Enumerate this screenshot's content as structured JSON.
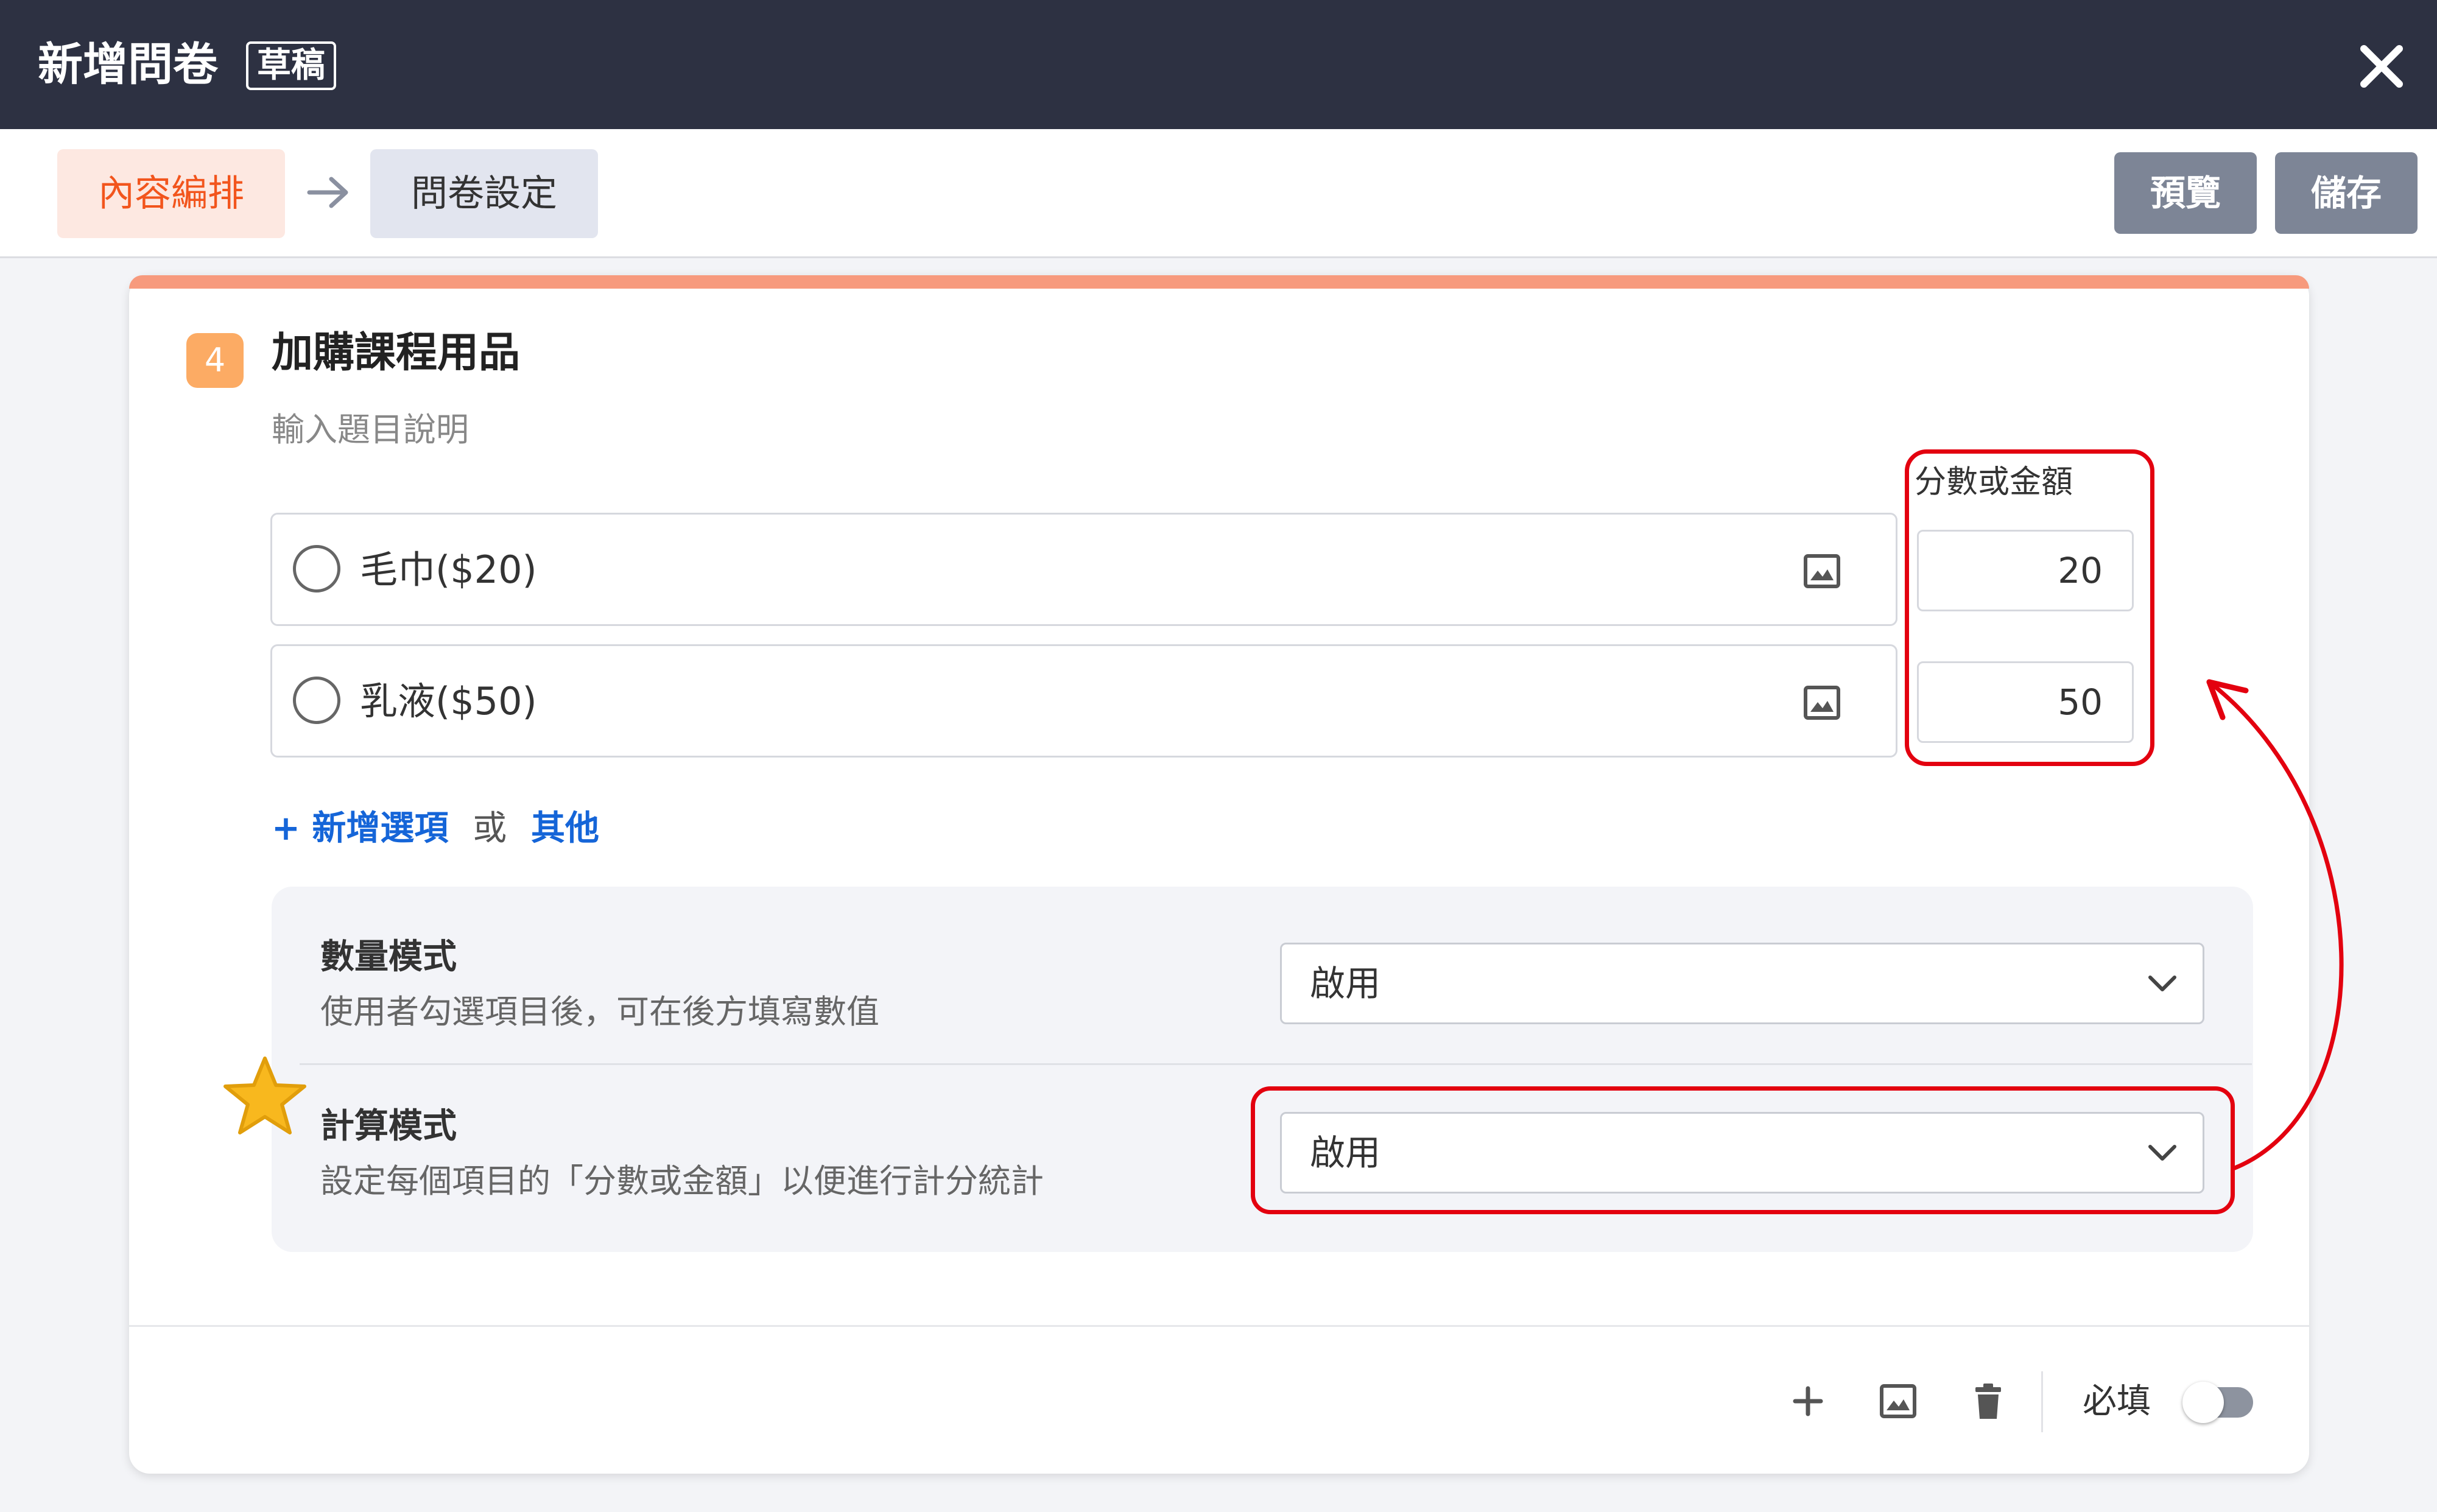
{
  "header": {
    "title": "新增問卷",
    "badge": "草稿",
    "close_icon": "close-icon"
  },
  "toolbar": {
    "steps": [
      {
        "label": "內容編排",
        "active": true
      },
      {
        "label": "問卷設定",
        "active": false
      }
    ],
    "preview_label": "預覽",
    "save_label": "儲存"
  },
  "question": {
    "number": "4",
    "title": "加購課程用品",
    "description_placeholder": "輸入題目說明",
    "score_header": "分數或金額",
    "options": [
      {
        "label": "毛巾($20)",
        "score": "20"
      },
      {
        "label": "乳液($50)",
        "score": "50"
      }
    ],
    "add_option_label": "+ 新增選項",
    "or_label": "或",
    "other_label": "其他",
    "settings": [
      {
        "title": "數量模式",
        "description": "使用者勾選項目後，可在後方填寫數值",
        "value": "啟用"
      },
      {
        "title": "計算模式",
        "description": "設定每個項目的「分數或金額」以便進行計分統計",
        "value": "啟用"
      }
    ],
    "footer": {
      "required_label": "必填",
      "required_on": false
    }
  },
  "colors": {
    "header_bg": "#2d3142",
    "accent": "#f2551d",
    "link": "#1565d8",
    "highlight": "#e3000f",
    "badge": "#fcab64"
  }
}
